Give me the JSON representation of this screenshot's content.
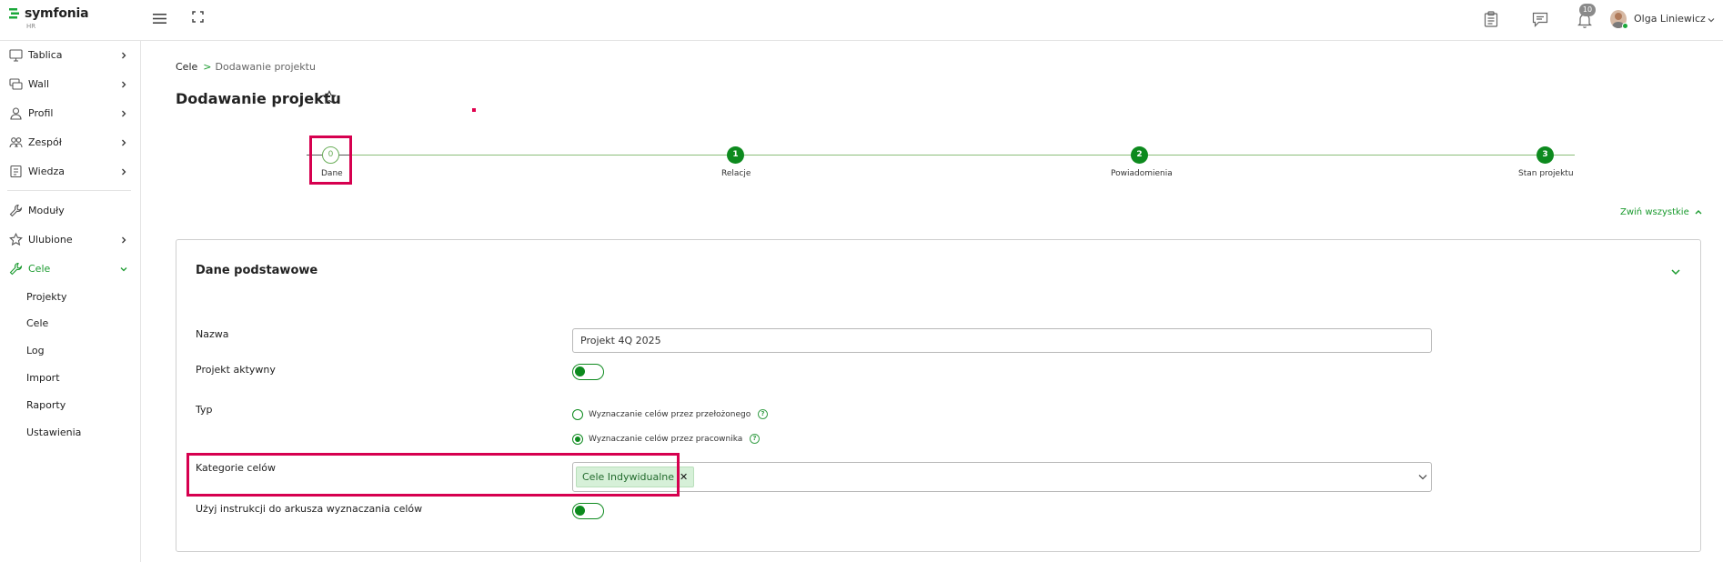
{
  "app": {
    "logo_text": "symfonia",
    "logo_sub": "HR",
    "notifications_count": "10",
    "user_name": "Olga Liniewicz"
  },
  "sidebar": {
    "items": [
      {
        "label": "Tablica",
        "icon": "monitor-icon"
      },
      {
        "label": "Wall",
        "icon": "wall-icon"
      },
      {
        "label": "Profil",
        "icon": "user-icon"
      },
      {
        "label": "Zespół",
        "icon": "team-icon"
      },
      {
        "label": "Wiedza",
        "icon": "book-icon"
      },
      {
        "label": "Moduły",
        "icon": "wrench-icon"
      },
      {
        "label": "Ulubione",
        "icon": "star-icon"
      },
      {
        "label": "Cele",
        "icon": "wrench-icon"
      }
    ],
    "sub_items": [
      "Projekty",
      "Cele",
      "Log",
      "Import",
      "Raporty",
      "Ustawienia"
    ]
  },
  "breadcrumb": {
    "root": "Cele",
    "separator": ">",
    "current": "Dodawanie projektu"
  },
  "page_title": "Dodawanie projektu",
  "stepper": {
    "steps": [
      {
        "number": "0",
        "label": "Dane",
        "state": "current"
      },
      {
        "number": "1",
        "label": "Relacje",
        "state": "pending"
      },
      {
        "number": "2",
        "label": "Powiadomienia",
        "state": "pending"
      },
      {
        "number": "3",
        "label": "Stan projektu",
        "state": "pending"
      }
    ]
  },
  "collapse_all_label": "Zwiń wszystkie",
  "card": {
    "title": "Dane podstawowe",
    "fields": {
      "name_label": "Nazwa",
      "name_value": "Projekt 4Q 2025",
      "active_label": "Projekt aktywny",
      "active_value": true,
      "type_label": "Typ",
      "type_options": [
        {
          "label": "Wyznaczanie celów przez przełożonego",
          "selected": false
        },
        {
          "label": "Wyznaczanie celów przez pracownika",
          "selected": true
        }
      ],
      "categories_label": "Kategorie celów",
      "categories_selected": [
        "Cele Indywidualne"
      ],
      "instructions_label": "Użyj instrukcji do arkusza wyznaczania celów",
      "instructions_value": true
    }
  },
  "colors": {
    "accent": "#0d8a1e",
    "highlight": "#d6004f",
    "tag_bg": "#d6f0d8"
  }
}
